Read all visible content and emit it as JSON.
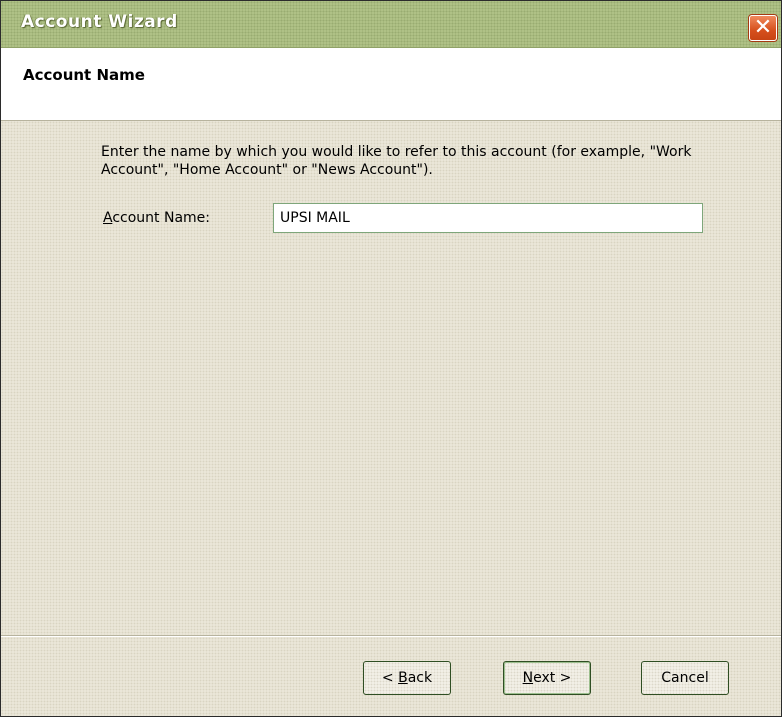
{
  "window": {
    "title": "Account Wizard",
    "close_icon": "close-icon",
    "accent": "#b2c489",
    "close_color": "#d6501d"
  },
  "header": {
    "title": "Account Name"
  },
  "main": {
    "description": "Enter the name by which you would like to refer to this account (for example, \"Work Account\", \"Home Account\" or \"News Account\").",
    "field_label_mnemonic": "A",
    "field_label_rest": "ccount Name:",
    "field_value": "UPSI MAIL"
  },
  "footer": {
    "back_prefix": "< ",
    "back_mnemonic": "B",
    "back_rest": "ack",
    "next_mnemonic": "N",
    "next_rest": "ext >",
    "cancel_label": "Cancel"
  }
}
